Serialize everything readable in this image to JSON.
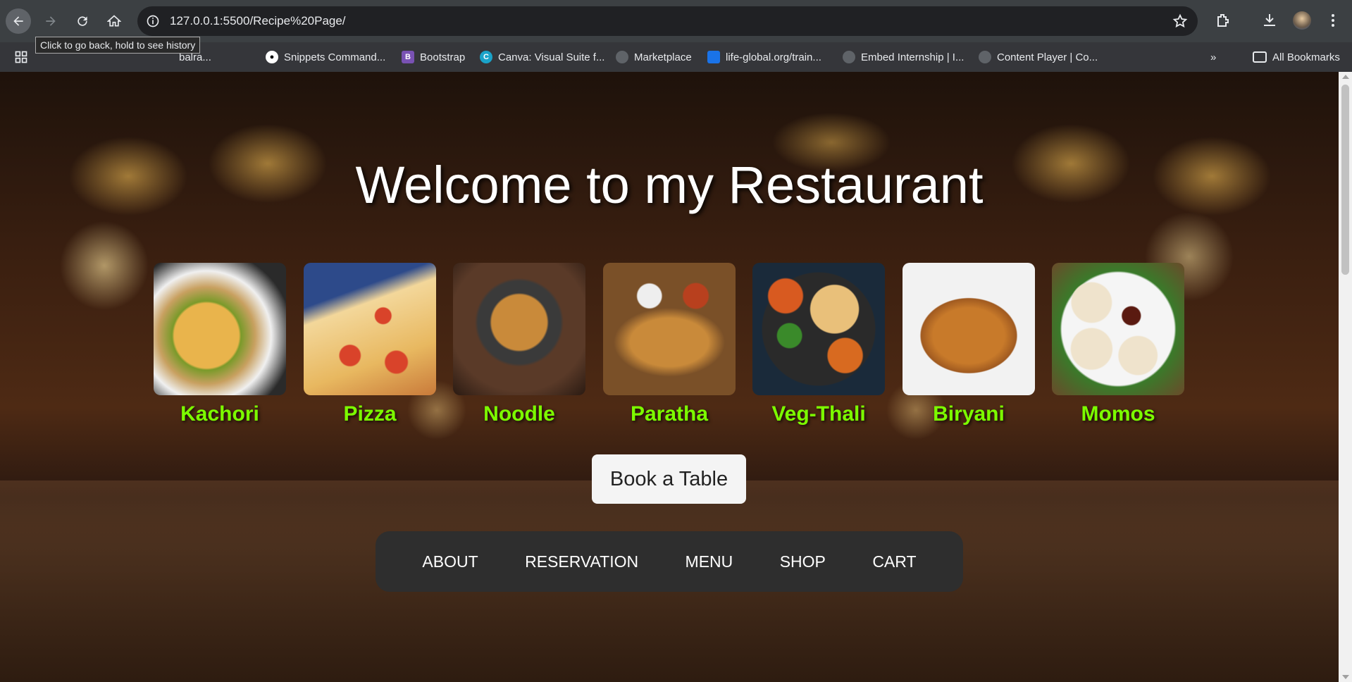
{
  "browser": {
    "url": "127.0.0.1:5500/Recipe%20Page/",
    "tooltip": "Click to go back, hold to see history",
    "bookmarks": [
      {
        "label": "balra...",
        "icon": "globe-icon"
      },
      {
        "label": "Snippets Command...",
        "icon": "github-icon"
      },
      {
        "label": "Bootstrap",
        "icon": "bootstrap-icon"
      },
      {
        "label": "Canva: Visual Suite f...",
        "icon": "canva-icon"
      },
      {
        "label": "Marketplace",
        "icon": "globe-icon"
      },
      {
        "label": "life-global.org/train...",
        "icon": "life-icon"
      },
      {
        "label": "Embed Internship | I...",
        "icon": "globe-icon"
      },
      {
        "label": "Content Player | Co...",
        "icon": "globe-icon"
      }
    ],
    "all_bookmarks": "All Bookmarks"
  },
  "page": {
    "title": "Welcome to my Restaurant",
    "dishes": [
      {
        "name": "Kachori"
      },
      {
        "name": "Pizza"
      },
      {
        "name": "Noodle"
      },
      {
        "name": "Paratha"
      },
      {
        "name": "Veg-Thali"
      },
      {
        "name": "Biryani"
      },
      {
        "name": "Momos"
      }
    ],
    "book_button": "Book a Table",
    "nav": [
      "ABOUT",
      "RESERVATION",
      "MENU",
      "SHOP",
      "CART"
    ]
  },
  "colors": {
    "dish_name": "#7cfc00",
    "nav_bg": "#2e2e2e",
    "button_bg": "#f4f4f4"
  }
}
